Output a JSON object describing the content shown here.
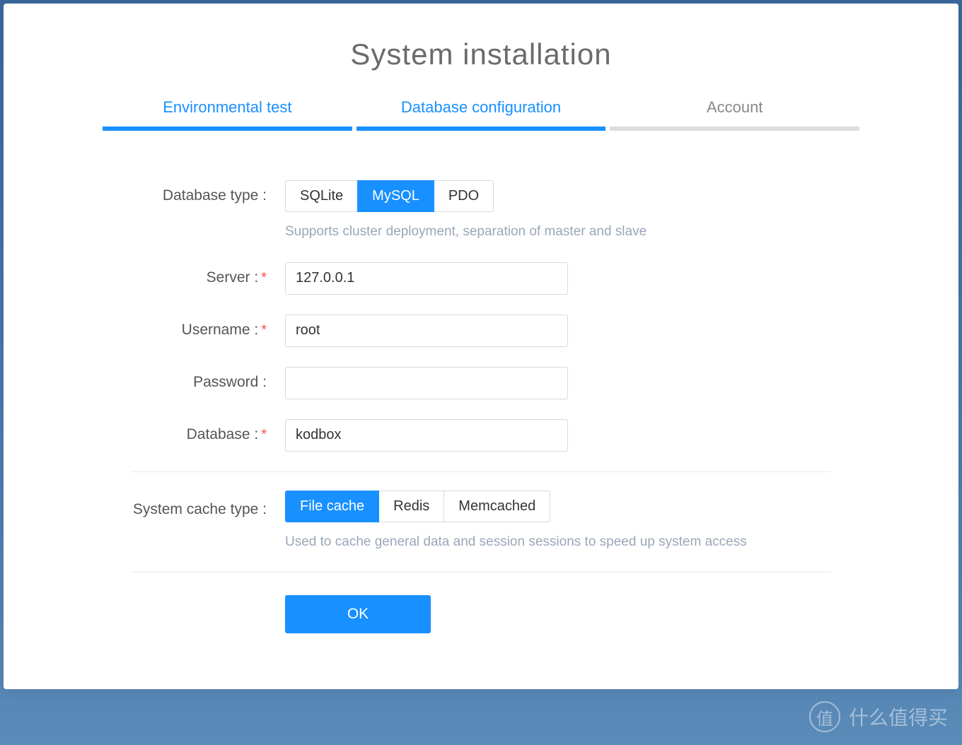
{
  "title": "System installation",
  "steps": [
    {
      "label": "Environmental test",
      "state": "done"
    },
    {
      "label": "Database configuration",
      "state": "active"
    },
    {
      "label": "Account",
      "state": "pending"
    }
  ],
  "form": {
    "db_type": {
      "label": "Database type :",
      "options": [
        "SQLite",
        "MySQL",
        "PDO"
      ],
      "selected": "MySQL",
      "help": "Supports cluster deployment, separation of master and slave"
    },
    "server": {
      "label": "Server :",
      "value": "127.0.0.1",
      "required": true
    },
    "username": {
      "label": "Username :",
      "value": "root",
      "required": true
    },
    "password": {
      "label": "Password :",
      "value": "",
      "required": false
    },
    "database": {
      "label": "Database :",
      "value": "kodbox",
      "required": true
    },
    "cache_type": {
      "label": "System cache type :",
      "options": [
        "File cache",
        "Redis",
        "Memcached"
      ],
      "selected": "File cache",
      "help": "Used to cache general data and session sessions to speed up system access"
    },
    "submit_label": "OK"
  },
  "watermark": {
    "icon": "值",
    "text": "什么值得买"
  },
  "colors": {
    "primary": "#1890ff",
    "text_muted": "#9aa7b8",
    "border": "#d9d9d9"
  }
}
